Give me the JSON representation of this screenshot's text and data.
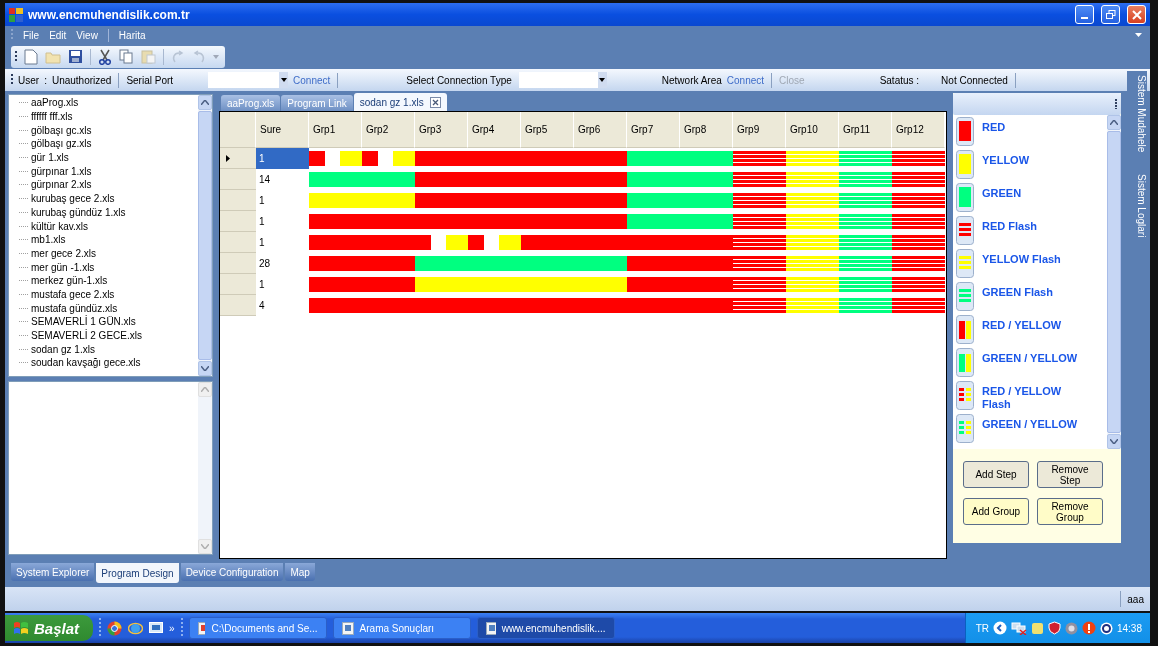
{
  "window": {
    "title": "www.encmuhendislik.com.tr"
  },
  "menu": [
    {
      "label": "File",
      "separator_before": false
    },
    {
      "label": "Edit",
      "separator_before": false
    },
    {
      "label": "View",
      "separator_before": false
    },
    {
      "label": "Harita",
      "separator_before": true
    }
  ],
  "connection_bar": {
    "user_label": "User",
    "user_sep": ":",
    "user_value": "Unauthorized",
    "serial_port_label": "Serial Port",
    "serial_connect": "Connect",
    "connection_type_label": "Select Connection Type",
    "network_area_label": "Network Area",
    "network_connect": "Connect",
    "network_close": {
      "label": "Close",
      "disabled": true
    },
    "status_label": "Satatus :",
    "status_value": "Not Connected"
  },
  "file_tree": [
    "aaProg.xls",
    "ffffff  fff.xls",
    "gölbaşı gc.xls",
    "gölbaşı gz.xls",
    "gür 1.xls",
    "gürpınar 1.xls",
    "gürpınar 2.xls",
    "kurubaş gece 2.xls",
    "kurubaş gündüz 1.xls",
    "kültür kav.xls",
    "mb1.xls",
    "mer gece 2.xls",
    "mer gün -1.xls",
    "merkez gün-1.xls",
    "mustafa gece 2.xls",
    "mustafa gündüz.xls",
    "SEMAVERLİ 1 GÜN.xls",
    "SEMAVERLİ 2 GECE.xls",
    "sodan gz 1.xls",
    "soudan kavşağı gece.xls"
  ],
  "document_tabs": [
    {
      "label": "aaProg.xls",
      "selected": false
    },
    {
      "label": "Program Link",
      "selected": false
    },
    {
      "label": "sodan gz 1.xls",
      "selected": true
    }
  ],
  "grid": {
    "columns": [
      "Sure",
      "Grp1",
      "Grp2",
      "Grp3",
      "Grp4",
      "Grp5",
      "Grp6",
      "Grp7",
      "Grp8",
      "Grp9",
      "Grp10",
      "Grp11",
      "Grp12"
    ],
    "rows": [
      {
        "sure": "1",
        "selected": true,
        "cells": [
          {
            "kind": "red_yellow_flash"
          },
          {
            "kind": "red_yellow_flash"
          },
          {
            "kind": "red"
          },
          {
            "kind": "red"
          },
          {
            "kind": "red"
          },
          {
            "kind": "red"
          },
          {
            "kind": "green"
          },
          {
            "kind": "green"
          },
          {
            "kind": "red_flash"
          },
          {
            "kind": "yellow_flash"
          },
          {
            "kind": "green_flash"
          },
          {
            "kind": "red_flash"
          }
        ]
      },
      {
        "sure": "14",
        "selected": false,
        "cells": [
          {
            "kind": "green"
          },
          {
            "kind": "green"
          },
          {
            "kind": "red"
          },
          {
            "kind": "red"
          },
          {
            "kind": "red"
          },
          {
            "kind": "red"
          },
          {
            "kind": "green"
          },
          {
            "kind": "green"
          },
          {
            "kind": "red_flash"
          },
          {
            "kind": "yellow_flash"
          },
          {
            "kind": "green_flash"
          },
          {
            "kind": "red_flash"
          }
        ]
      },
      {
        "sure": "1",
        "selected": false,
        "cells": [
          {
            "kind": "yellow"
          },
          {
            "kind": "yellow"
          },
          {
            "kind": "red"
          },
          {
            "kind": "red"
          },
          {
            "kind": "red"
          },
          {
            "kind": "red"
          },
          {
            "kind": "green"
          },
          {
            "kind": "green"
          },
          {
            "kind": "red_flash"
          },
          {
            "kind": "yellow_flash"
          },
          {
            "kind": "green_flash"
          },
          {
            "kind": "red_flash"
          }
        ]
      },
      {
        "sure": "1",
        "selected": false,
        "cells": [
          {
            "kind": "red"
          },
          {
            "kind": "red"
          },
          {
            "kind": "red"
          },
          {
            "kind": "red"
          },
          {
            "kind": "red"
          },
          {
            "kind": "red"
          },
          {
            "kind": "green"
          },
          {
            "kind": "green"
          },
          {
            "kind": "red_flash"
          },
          {
            "kind": "yellow_flash"
          },
          {
            "kind": "green_flash"
          },
          {
            "kind": "red_flash"
          }
        ]
      },
      {
        "sure": "1",
        "selected": false,
        "cells": [
          {
            "kind": "red"
          },
          {
            "kind": "red"
          },
          {
            "kind": "red_yellow_flash"
          },
          {
            "kind": "red_yellow_flash"
          },
          {
            "kind": "red"
          },
          {
            "kind": "red"
          },
          {
            "kind": "red"
          },
          {
            "kind": "red"
          },
          {
            "kind": "red_flash"
          },
          {
            "kind": "yellow_flash"
          },
          {
            "kind": "green_flash"
          },
          {
            "kind": "red_flash"
          }
        ]
      },
      {
        "sure": "28",
        "selected": false,
        "cells": [
          {
            "kind": "red"
          },
          {
            "kind": "red"
          },
          {
            "kind": "green"
          },
          {
            "kind": "green"
          },
          {
            "kind": "green"
          },
          {
            "kind": "green"
          },
          {
            "kind": "red"
          },
          {
            "kind": "red"
          },
          {
            "kind": "red_flash"
          },
          {
            "kind": "yellow_flash"
          },
          {
            "kind": "green_flash"
          },
          {
            "kind": "red_flash"
          }
        ]
      },
      {
        "sure": "1",
        "selected": false,
        "cells": [
          {
            "kind": "red"
          },
          {
            "kind": "red"
          },
          {
            "kind": "yellow"
          },
          {
            "kind": "yellow"
          },
          {
            "kind": "yellow"
          },
          {
            "kind": "yellow"
          },
          {
            "kind": "red"
          },
          {
            "kind": "red"
          },
          {
            "kind": "red_flash"
          },
          {
            "kind": "yellow_flash"
          },
          {
            "kind": "green_flash"
          },
          {
            "kind": "red_flash"
          }
        ]
      },
      {
        "sure": "4",
        "selected": false,
        "cells": [
          {
            "kind": "red"
          },
          {
            "kind": "red"
          },
          {
            "kind": "red"
          },
          {
            "kind": "red"
          },
          {
            "kind": "red"
          },
          {
            "kind": "red"
          },
          {
            "kind": "red"
          },
          {
            "kind": "red"
          },
          {
            "kind": "red_flash"
          },
          {
            "kind": "yellow_flash"
          },
          {
            "kind": "green_flash"
          },
          {
            "kind": "red_flash"
          }
        ]
      }
    ]
  },
  "palette": [
    {
      "label": "RED",
      "kind": "red"
    },
    {
      "label": "YELLOW",
      "kind": "yellow"
    },
    {
      "label": "GREEN",
      "kind": "green"
    },
    {
      "label": "RED Flash",
      "kind": "red_flash"
    },
    {
      "label": "YELLOW Flash",
      "kind": "yellow_flash"
    },
    {
      "label": "GREEN Flash",
      "kind": "green_flash"
    },
    {
      "label": "RED / YELLOW",
      "kind": "red_yellow"
    },
    {
      "label": "GREEN / YELLOW",
      "kind": "green_yellow"
    },
    {
      "label": "RED / YELLOW Flash",
      "kind": "red_yellow_flash"
    },
    {
      "label": "GREEN / YELLOW",
      "kind": "green_yellow_flash"
    }
  ],
  "palette_buttons": [
    {
      "label": "Add Step",
      "kind": "step"
    },
    {
      "label": "Remove Step",
      "kind": "step"
    },
    {
      "label": "Add Group",
      "kind": "group"
    },
    {
      "label": "Remove Group",
      "kind": "group"
    }
  ],
  "side_tabs": [
    "Sistem Mudahele",
    "Sistem Loglari"
  ],
  "bottom_tabs": [
    {
      "label": "System Explorer",
      "selected": false
    },
    {
      "label": "Program Design",
      "selected": true
    },
    {
      "label": "Device Configuration",
      "selected": false
    },
    {
      "label": "Map",
      "selected": false
    }
  ],
  "status_bar": {
    "text": "aaa"
  },
  "taskbar": {
    "start": "Başlat",
    "chevron": "»",
    "tasks": [
      {
        "label": "C:\\Documents and Se...",
        "selected": false
      },
      {
        "label": "Arama Sonuçları",
        "selected": false
      },
      {
        "label": "www.encmuhendislik....",
        "selected": true
      }
    ],
    "language": "TR",
    "clock": "14:38"
  }
}
